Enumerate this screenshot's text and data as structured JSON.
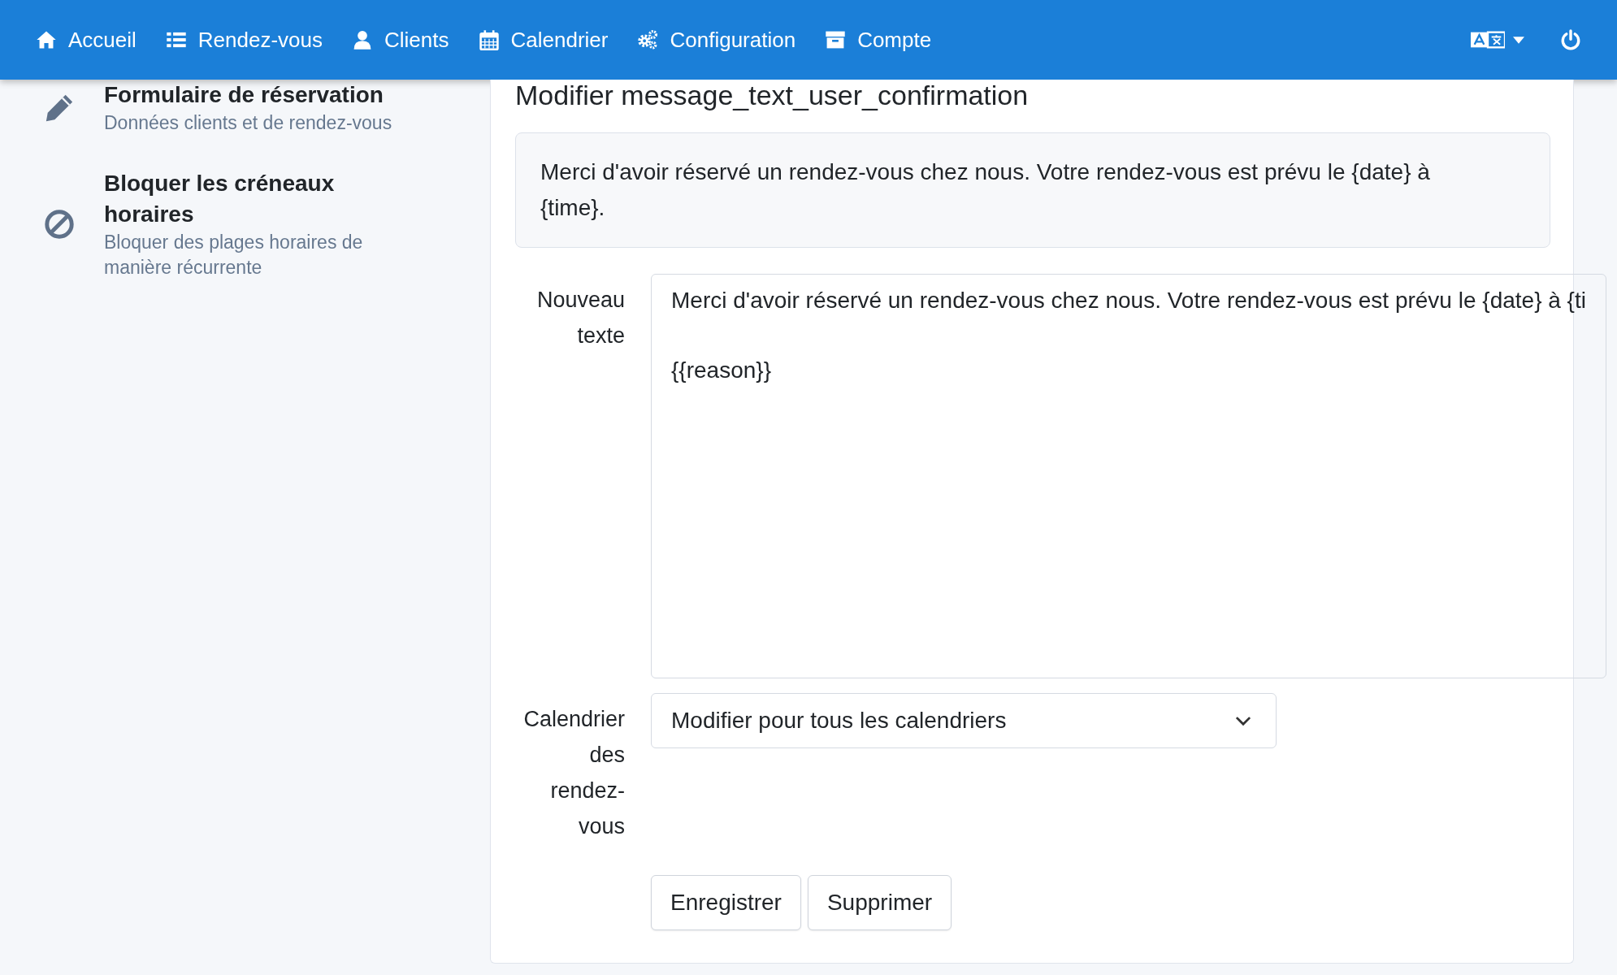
{
  "navbar": {
    "items": [
      {
        "kind": "home",
        "label": "Accueil"
      },
      {
        "kind": "list",
        "label": "Rendez-vous"
      },
      {
        "kind": "user",
        "label": "Clients"
      },
      {
        "kind": "calendar",
        "label": "Calendrier"
      },
      {
        "kind": "gears",
        "label": "Configuration"
      },
      {
        "kind": "archive",
        "label": "Compte"
      }
    ]
  },
  "sidebar": {
    "items": [
      {
        "kind": "pencil",
        "title": "Formulaire de réservation",
        "subtitle": "Données clients et de rendez-vous"
      },
      {
        "kind": "ban",
        "title": "Bloquer les créneaux horaires",
        "subtitle": "Bloquer des plages horaires de manière récurrente"
      }
    ]
  },
  "editor": {
    "title": "Modifier  message_text_user_confirmation",
    "current_text": "Merci d'avoir réservé un rendez-vous chez nous. Votre rendez-vous est prévu le {date} à {time}.",
    "new_text_label": "Nouveau texte",
    "new_text_value": "Merci d'avoir réservé un rendez-vous chez nous. Votre rendez-vous est prévu le {date} à {ti\n\n{{reason}}",
    "calendar_label": "Calendrier des rendez-vous",
    "calendar_select": "Modifier pour tous les calendriers",
    "buttons": [
      "Enregistrer",
      "Supprimer"
    ]
  }
}
